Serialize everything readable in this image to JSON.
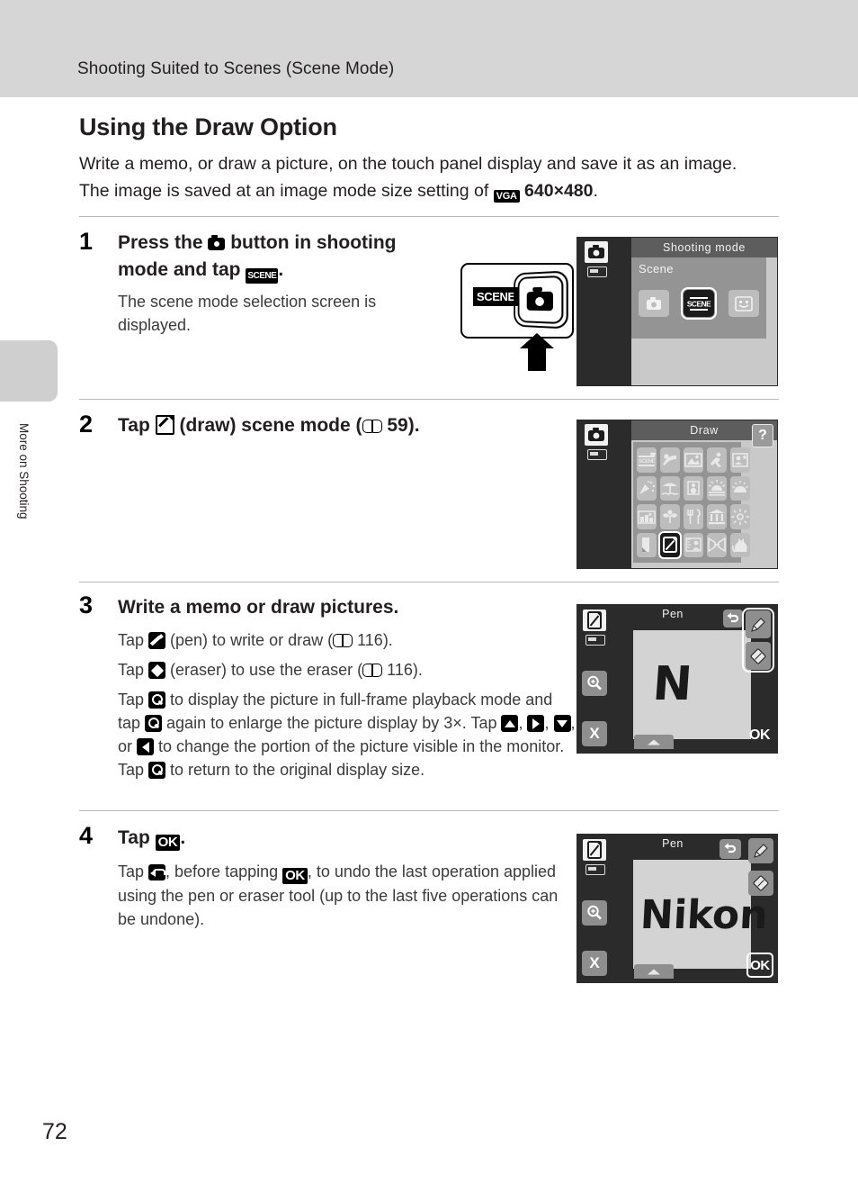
{
  "header": {
    "running_title": "Shooting Suited to Scenes (Scene Mode)"
  },
  "side_tab": {
    "label": "More on Shooting"
  },
  "page_number": "72",
  "section": {
    "heading": "Using the Draw Option",
    "intro_part1": "Write a memo, or draw a picture, on the touch panel display and save it as an image. The image is saved at an image mode size setting of ",
    "intro_vga_icon": "VGA",
    "intro_size": "640×480",
    "intro_period": "."
  },
  "steps": [
    {
      "number": "1",
      "head_part1": "Press the ",
      "head_icon1": "camera-icon",
      "head_part2": " button in shooting mode and tap ",
      "head_icon2": "SCENE",
      "head_part3": ".",
      "body": "The scene mode selection screen is displayed."
    },
    {
      "number": "2",
      "head_part1": "Tap ",
      "head_icon1": "draw-icon",
      "head_part2": " (draw) scene mode (",
      "head_book": "book-icon",
      "head_page_ref": " 59).",
      "body": ""
    },
    {
      "number": "3",
      "head": "Write a memo or draw pictures.",
      "body_lines": [
        "Tap [pen] (pen) to write or draw ([book] 116).",
        "Tap [eraser] (eraser) to use the eraser ([book] 116).",
        "Tap [zoom] to display the picture in full-frame playback mode and tap [zoom] again to enlarge the picture display by 3×. Tap [up], [right], [down], or [left] to change the portion of the picture visible in the monitor. Tap [zoom] to return to the original display size."
      ],
      "pen_ref_page": "116",
      "eraser_ref_page": "116",
      "zoom_factor": "3×"
    },
    {
      "number": "4",
      "head_part1": "Tap ",
      "head_icon1": "OK",
      "head_part2": ".",
      "body_part1": "Tap ",
      "body_icon1": "undo-icon",
      "body_part2": ", before tapping ",
      "body_icon2": "OK",
      "body_part3": ", to undo the last operation applied using the pen or eraser tool (up to the last five operations can be undone)."
    }
  ],
  "illustration": {
    "scene_chip_label": "SCENE",
    "button_icon": "camera-button-icon",
    "arrow": "press-arrow-up-icon"
  },
  "screens": {
    "shooting_mode": {
      "title": "Shooting mode",
      "panel_label": "Scene",
      "modes": [
        {
          "name": "auto-mode-icon",
          "selected": false
        },
        {
          "name": "scene-mode-icon",
          "label": "SCENE",
          "selected": true
        },
        {
          "name": "smart-portrait-icon",
          "selected": false
        }
      ]
    },
    "draw_scene_menu": {
      "title": "Draw",
      "help_label": "?",
      "icons": [
        "scene-auto-icon",
        "portrait-icon",
        "landscape-icon",
        "sports-icon",
        "night-portrait-icon",
        "party-indoor-icon",
        "beach-icon",
        "snow-icon",
        "sunset-icon",
        "dusk-dawn-icon",
        "night-landscape-icon",
        "close-up-icon",
        "food-icon",
        "museum-icon",
        "fireworks-icon",
        "copy-icon",
        "draw-icon",
        "backlight-icon",
        "panorama-icon",
        "pet-portrait-icon"
      ],
      "selected_index": 16
    },
    "pen_screen_1": {
      "title": "Pen",
      "mode_icon": "draw-mode-icon",
      "battery_icon": "battery-icon",
      "zoom_icon": "zoom-in-icon",
      "cancel_label": "X",
      "ok_label": "OK",
      "undo_icon": "undo-icon",
      "pen_icon": "pen-icon",
      "eraser_icon": "eraser-icon",
      "canvas_text": "N",
      "tools_highlighted": true
    },
    "pen_screen_2": {
      "title": "Pen",
      "mode_icon": "draw-mode-icon",
      "battery_icon": "battery-icon",
      "zoom_icon": "zoom-in-icon",
      "cancel_label": "X",
      "ok_label": "OK",
      "undo_icon": "undo-icon",
      "pen_icon": "pen-icon",
      "eraser_icon": "eraser-icon",
      "canvas_text": "Nikon",
      "ok_highlighted": true
    }
  },
  "colors": {
    "header_band": "#d6d6d6",
    "side_tab": "#cfcfcf",
    "lcd_bezel": "#2b2b2b",
    "lcd_panel": "#949494",
    "lcd_body": "#c9c9c9",
    "text": "#231f20"
  }
}
